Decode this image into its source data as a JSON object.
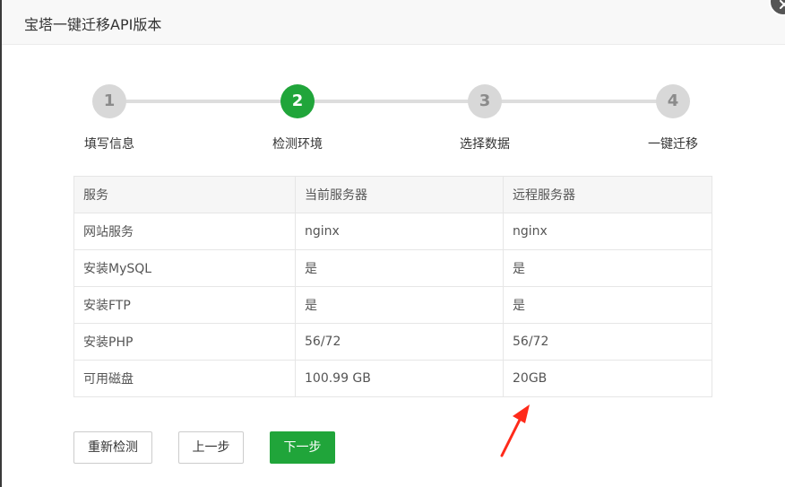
{
  "dialog": {
    "title": "宝塔一键迁移API版本"
  },
  "steps": [
    {
      "number": "1",
      "label": "填写信息",
      "state": "done"
    },
    {
      "number": "2",
      "label": "检测环境",
      "state": "active"
    },
    {
      "number": "3",
      "label": "选择数据",
      "state": "pending"
    },
    {
      "number": "4",
      "label": "一键迁移",
      "state": "pending"
    }
  ],
  "table": {
    "headers": [
      "服务",
      "当前服务器",
      "远程服务器"
    ],
    "rows": [
      [
        "网站服务",
        "nginx",
        "nginx"
      ],
      [
        "安装MySQL",
        "是",
        "是"
      ],
      [
        "安装FTP",
        "是",
        "是"
      ],
      [
        "安装PHP",
        "56/72",
        "56/72"
      ],
      [
        "可用磁盘",
        "100.99 GB",
        "20GB"
      ]
    ]
  },
  "buttons": {
    "recheck": "重新检测",
    "prev": "上一步",
    "next": "下一步"
  },
  "colors": {
    "accent": "#20a53a",
    "annotation_arrow": "#ff2a1a"
  },
  "icons": {
    "close": "close-icon",
    "annotation": "red-arrow-annotation"
  }
}
